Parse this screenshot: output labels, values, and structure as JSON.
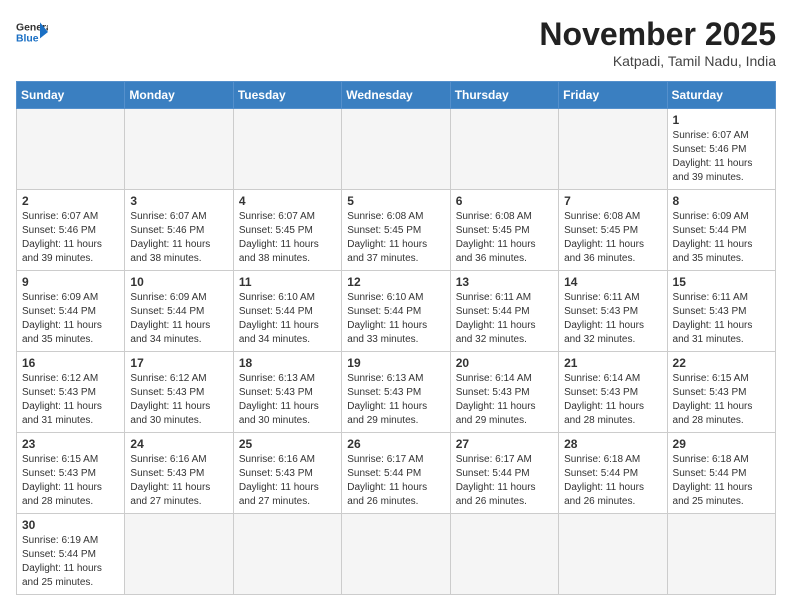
{
  "header": {
    "logo_general": "General",
    "logo_blue": "Blue",
    "month_title": "November 2025",
    "location": "Katpadi, Tamil Nadu, India"
  },
  "weekdays": [
    "Sunday",
    "Monday",
    "Tuesday",
    "Wednesday",
    "Thursday",
    "Friday",
    "Saturday"
  ],
  "weeks": [
    [
      {
        "day": null,
        "info": null
      },
      {
        "day": null,
        "info": null
      },
      {
        "day": null,
        "info": null
      },
      {
        "day": null,
        "info": null
      },
      {
        "day": null,
        "info": null
      },
      {
        "day": null,
        "info": null
      },
      {
        "day": "1",
        "info": "Sunrise: 6:07 AM\nSunset: 5:46 PM\nDaylight: 11 hours\nand 39 minutes."
      }
    ],
    [
      {
        "day": "2",
        "info": "Sunrise: 6:07 AM\nSunset: 5:46 PM\nDaylight: 11 hours\nand 39 minutes."
      },
      {
        "day": "3",
        "info": "Sunrise: 6:07 AM\nSunset: 5:46 PM\nDaylight: 11 hours\nand 38 minutes."
      },
      {
        "day": "4",
        "info": "Sunrise: 6:07 AM\nSunset: 5:45 PM\nDaylight: 11 hours\nand 38 minutes."
      },
      {
        "day": "5",
        "info": "Sunrise: 6:08 AM\nSunset: 5:45 PM\nDaylight: 11 hours\nand 37 minutes."
      },
      {
        "day": "6",
        "info": "Sunrise: 6:08 AM\nSunset: 5:45 PM\nDaylight: 11 hours\nand 36 minutes."
      },
      {
        "day": "7",
        "info": "Sunrise: 6:08 AM\nSunset: 5:45 PM\nDaylight: 11 hours\nand 36 minutes."
      },
      {
        "day": "8",
        "info": "Sunrise: 6:09 AM\nSunset: 5:44 PM\nDaylight: 11 hours\nand 35 minutes."
      }
    ],
    [
      {
        "day": "9",
        "info": "Sunrise: 6:09 AM\nSunset: 5:44 PM\nDaylight: 11 hours\nand 35 minutes."
      },
      {
        "day": "10",
        "info": "Sunrise: 6:09 AM\nSunset: 5:44 PM\nDaylight: 11 hours\nand 34 minutes."
      },
      {
        "day": "11",
        "info": "Sunrise: 6:10 AM\nSunset: 5:44 PM\nDaylight: 11 hours\nand 34 minutes."
      },
      {
        "day": "12",
        "info": "Sunrise: 6:10 AM\nSunset: 5:44 PM\nDaylight: 11 hours\nand 33 minutes."
      },
      {
        "day": "13",
        "info": "Sunrise: 6:11 AM\nSunset: 5:44 PM\nDaylight: 11 hours\nand 32 minutes."
      },
      {
        "day": "14",
        "info": "Sunrise: 6:11 AM\nSunset: 5:43 PM\nDaylight: 11 hours\nand 32 minutes."
      },
      {
        "day": "15",
        "info": "Sunrise: 6:11 AM\nSunset: 5:43 PM\nDaylight: 11 hours\nand 31 minutes."
      }
    ],
    [
      {
        "day": "16",
        "info": "Sunrise: 6:12 AM\nSunset: 5:43 PM\nDaylight: 11 hours\nand 31 minutes."
      },
      {
        "day": "17",
        "info": "Sunrise: 6:12 AM\nSunset: 5:43 PM\nDaylight: 11 hours\nand 30 minutes."
      },
      {
        "day": "18",
        "info": "Sunrise: 6:13 AM\nSunset: 5:43 PM\nDaylight: 11 hours\nand 30 minutes."
      },
      {
        "day": "19",
        "info": "Sunrise: 6:13 AM\nSunset: 5:43 PM\nDaylight: 11 hours\nand 29 minutes."
      },
      {
        "day": "20",
        "info": "Sunrise: 6:14 AM\nSunset: 5:43 PM\nDaylight: 11 hours\nand 29 minutes."
      },
      {
        "day": "21",
        "info": "Sunrise: 6:14 AM\nSunset: 5:43 PM\nDaylight: 11 hours\nand 28 minutes."
      },
      {
        "day": "22",
        "info": "Sunrise: 6:15 AM\nSunset: 5:43 PM\nDaylight: 11 hours\nand 28 minutes."
      }
    ],
    [
      {
        "day": "23",
        "info": "Sunrise: 6:15 AM\nSunset: 5:43 PM\nDaylight: 11 hours\nand 28 minutes."
      },
      {
        "day": "24",
        "info": "Sunrise: 6:16 AM\nSunset: 5:43 PM\nDaylight: 11 hours\nand 27 minutes."
      },
      {
        "day": "25",
        "info": "Sunrise: 6:16 AM\nSunset: 5:43 PM\nDaylight: 11 hours\nand 27 minutes."
      },
      {
        "day": "26",
        "info": "Sunrise: 6:17 AM\nSunset: 5:44 PM\nDaylight: 11 hours\nand 26 minutes."
      },
      {
        "day": "27",
        "info": "Sunrise: 6:17 AM\nSunset: 5:44 PM\nDaylight: 11 hours\nand 26 minutes."
      },
      {
        "day": "28",
        "info": "Sunrise: 6:18 AM\nSunset: 5:44 PM\nDaylight: 11 hours\nand 26 minutes."
      },
      {
        "day": "29",
        "info": "Sunrise: 6:18 AM\nSunset: 5:44 PM\nDaylight: 11 hours\nand 25 minutes."
      }
    ],
    [
      {
        "day": "30",
        "info": "Sunrise: 6:19 AM\nSunset: 5:44 PM\nDaylight: 11 hours\nand 25 minutes."
      },
      {
        "day": null,
        "info": null
      },
      {
        "day": null,
        "info": null
      },
      {
        "day": null,
        "info": null
      },
      {
        "day": null,
        "info": null
      },
      {
        "day": null,
        "info": null
      },
      {
        "day": null,
        "info": null
      }
    ]
  ]
}
